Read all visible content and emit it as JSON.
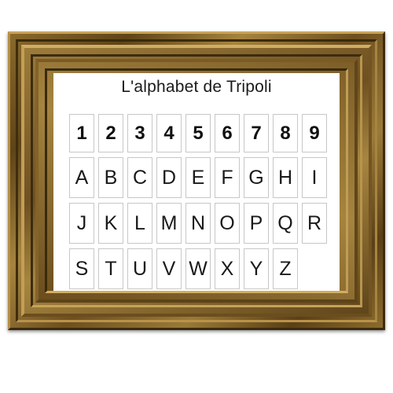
{
  "title": "L'alphabet de Tripoli",
  "colors": {
    "frame_gold": "#9a7a38",
    "frame_dark": "#3e2c10",
    "panel": "#ffffff",
    "cell_border": "#c7c7c7",
    "text": "#1a1a1a"
  },
  "grid": {
    "digits": [
      "1",
      "2",
      "3",
      "4",
      "5",
      "6",
      "7",
      "8",
      "9"
    ],
    "rows": [
      [
        "A",
        "B",
        "C",
        "D",
        "E",
        "F",
        "G",
        "H",
        "I"
      ],
      [
        "J",
        "K",
        "L",
        "M",
        "N",
        "O",
        "P",
        "Q",
        "R"
      ],
      [
        "S",
        "T",
        "U",
        "V",
        "W",
        "X",
        "Y",
        "Z"
      ]
    ]
  }
}
